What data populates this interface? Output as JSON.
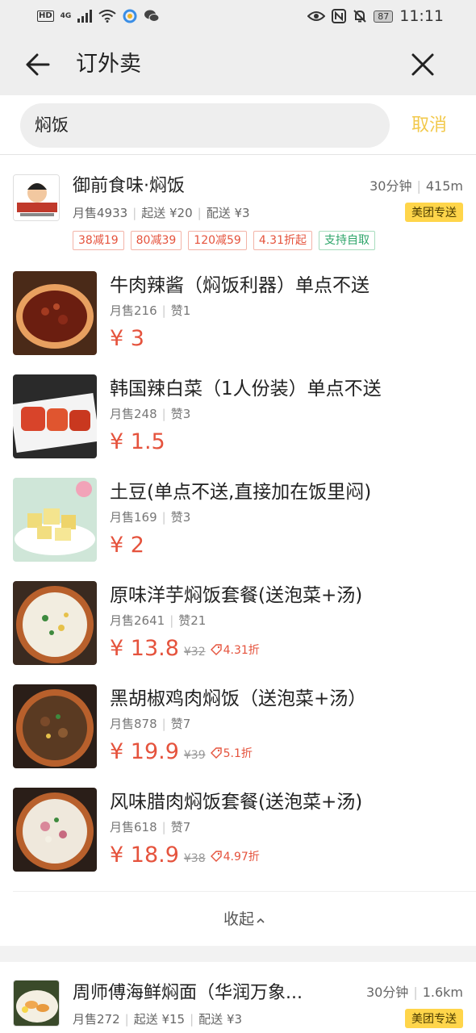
{
  "status_bar": {
    "hd": "HD",
    "network": "4G",
    "battery": "87",
    "time": "11:11"
  },
  "header": {
    "title": "订外卖"
  },
  "search": {
    "value": "焖饭",
    "cancel_label": "取消"
  },
  "shop1": {
    "name": "御前食味·焖饭",
    "time": "30分钟",
    "distance": "415m",
    "monthly_sales": "月售4933",
    "min_order": "起送 ¥20",
    "delivery_fee": "配送 ¥3",
    "badge": "美团专送",
    "promos": [
      "38减19",
      "80减39",
      "120减59",
      "4.31折起",
      "支持自取"
    ],
    "items": [
      {
        "name": "牛肉辣酱（焖饭利器）单点不送",
        "sales": "月售216",
        "likes": "赞1",
        "price": "¥ 3"
      },
      {
        "name": "韩国辣白菜（1人份装）单点不送",
        "sales": "月售248",
        "likes": "赞3",
        "price": "¥ 1.5"
      },
      {
        "name": "土豆(单点不送,直接加在饭里闷)",
        "sales": "月售169",
        "likes": "赞3",
        "price": "¥ 2"
      },
      {
        "name": "原味洋芋焖饭套餐(送泡菜+汤)",
        "sales": "月售2641",
        "likes": "赞21",
        "price": "¥ 13.8",
        "orig_price": "¥32",
        "discount": "4.31折"
      },
      {
        "name": "黑胡椒鸡肉焖饭（送泡菜+汤）",
        "sales": "月售878",
        "likes": "赞7",
        "price": "¥ 19.9",
        "orig_price": "¥39",
        "discount": "5.1折"
      },
      {
        "name": "风味腊肉焖饭套餐(送泡菜+汤)",
        "sales": "月售618",
        "likes": "赞7",
        "price": "¥ 18.9",
        "orig_price": "¥38",
        "discount": "4.97折"
      }
    ],
    "collapse_label": "收起"
  },
  "shop2": {
    "name": "周师傅海鲜焖面（华润万象...",
    "time": "30分钟",
    "distance": "1.6km",
    "monthly_sales": "月售272",
    "min_order": "起送 ¥15",
    "delivery_fee": "配送 ¥3",
    "badge": "美团专送"
  },
  "colors": {
    "accent_yellow": "#f2c94c",
    "price_red": "#e5533d",
    "badge_yellow": "#ffd54a",
    "promo_green": "#2ea56a"
  },
  "icons": [
    "back-arrow-icon",
    "close-icon",
    "tag-icon",
    "chevron-up-icon",
    "eye-icon",
    "nfc-icon",
    "mute-icon",
    "wifi-icon",
    "signal-icon"
  ]
}
